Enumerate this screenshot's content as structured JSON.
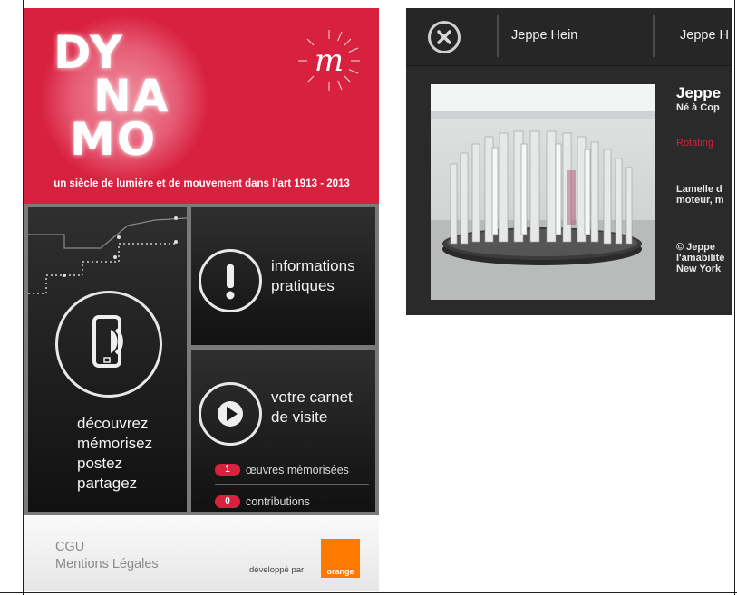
{
  "colors": {
    "brand_red": "#d8203f",
    "orange": "#ff7900",
    "dark": "#111111"
  },
  "home": {
    "logo_lines": [
      "DY",
      "NA",
      "MO"
    ],
    "logo_mark": "m",
    "tagline": "un siècle de lumière et de mouvement dans l’art 1913 - 2013",
    "tiles": {
      "discover": {
        "icon": "phone-sound-icon",
        "lines": [
          "découvrez",
          "mémorisez",
          "postez",
          "partagez"
        ]
      },
      "info": {
        "icon": "exclamation-icon",
        "lines": [
          "informations",
          "pratiques"
        ]
      },
      "carnet": {
        "icon": "play-icon",
        "lines": [
          "votre carnet",
          "de visite"
        ],
        "oeuvres_count": "1",
        "oeuvres_label": "œuvres mémorisées",
        "contributions_count": "0",
        "contributions_label": "contributions"
      }
    },
    "footer": {
      "cgu": "CGU",
      "mentions": "Mentions Légales",
      "developed_by": "développé par",
      "partner": "orange"
    }
  },
  "detail": {
    "close_icon": "close-icon",
    "tabs": [
      "Jeppe Hein",
      "Jeppe H"
    ],
    "artist_name": "Jeppe",
    "artist_born": "Né à Cop",
    "artwork_title": "Rotating",
    "artwork_desc": [
      "Lamelle d",
      "moteur, m"
    ],
    "credit": [
      "© Jeppe",
      "l'amabilité",
      "New York"
    ]
  }
}
